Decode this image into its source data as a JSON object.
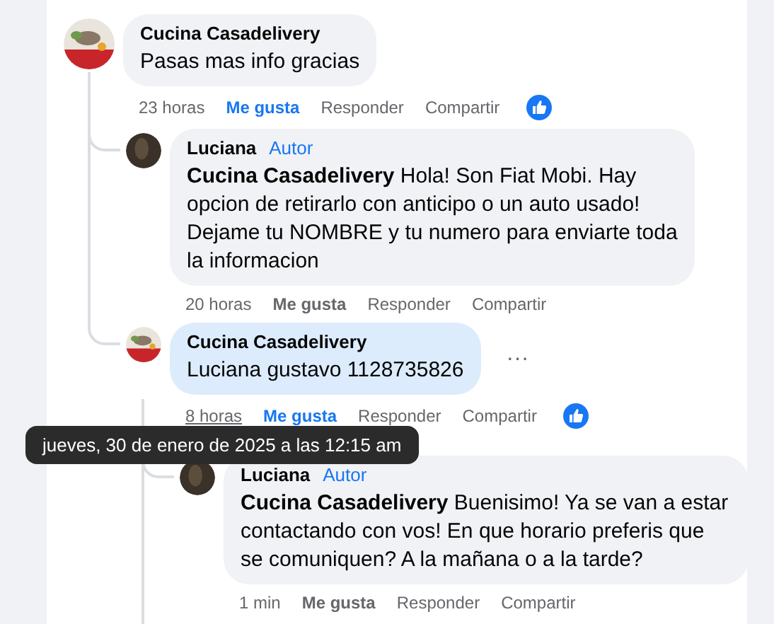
{
  "comments": [
    {
      "author": "Cucina Casadelivery",
      "body": "Pasas mas info gracias",
      "time": "23 horas",
      "time_hovered": false,
      "liked": true,
      "actions": [
        "Me gusta",
        "Responder",
        "Compartir"
      ],
      "reaction": true,
      "highlighted": false,
      "menu": false,
      "children": [
        {
          "author": "Luciana",
          "badge": "Autor",
          "body": "**Cucina Casadelivery** Hola! Son Fiat Mobi. Hay opcion de retirarlo con anticipo o un auto usado! Dejame tu NOMBRE y tu numero para enviarte toda la informacion",
          "time": "20 horas",
          "time_hovered": false,
          "liked": false,
          "actions": [
            "Me gusta",
            "Responder",
            "Compartir"
          ],
          "reaction": false,
          "highlighted": false,
          "menu": false
        },
        {
          "author": "Cucina Casadelivery",
          "body": "Luciana gustavo 1128735826",
          "time": "8 horas",
          "time_hovered": true,
          "liked": true,
          "actions": [
            "Me gusta",
            "Responder",
            "Compartir"
          ],
          "reaction": true,
          "highlighted": true,
          "menu": true,
          "children": [
            {
              "author": "Luciana",
              "badge": "Autor",
              "body": "**Cucina Casadelivery** Buenisimo! Ya se van a estar contactando con vos! En que horario preferis que se comuniquen? A la mañana o a la tarde?",
              "time": "1 min",
              "time_hovered": false,
              "liked": false,
              "actions": [
                "Me gusta",
                "Responder",
                "Compartir"
              ],
              "reaction": false,
              "highlighted": false,
              "menu": false
            }
          ]
        }
      ]
    }
  ],
  "tooltip": {
    "text": "jueves, 30 de enero de 2025 a las 12:15 am"
  },
  "menu_glyph": "···"
}
